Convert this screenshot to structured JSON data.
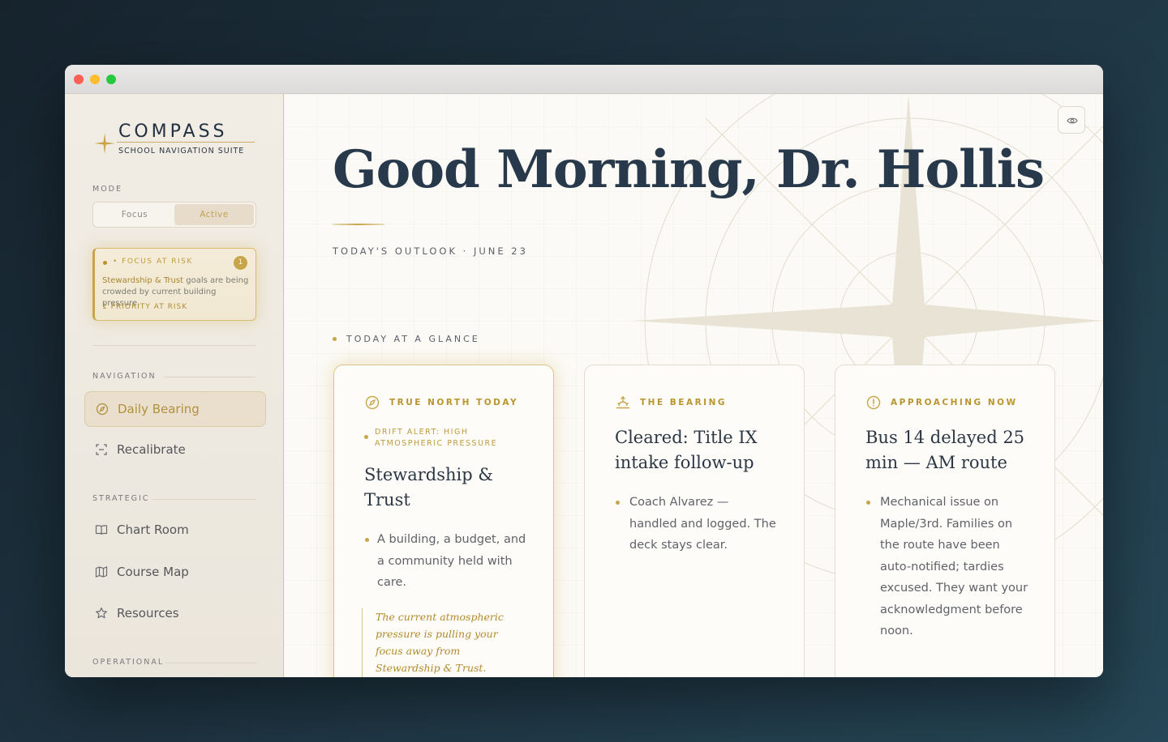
{
  "window": {
    "controls": [
      "close",
      "minimize",
      "zoom"
    ]
  },
  "brand": {
    "title": "COMPASS",
    "subtitle": "SCHOOL NAVIGATION SUITE",
    "icon": "compass-star-icon"
  },
  "mode": {
    "label": "MODE",
    "options": [
      "Focus",
      "Active"
    ],
    "selected": "Active"
  },
  "risk": {
    "title": "• FOCUS AT RISK",
    "count": "1",
    "highlight": "Stewardship & Trust",
    "text": " goals are being crowded by current building pressure.",
    "footer": "1 PRIORITY AT RISK"
  },
  "nav": {
    "navigation_label": "NAVIGATION",
    "strategic_label": "STRATEGIC",
    "operational_label": "OPERATIONAL",
    "items": [
      {
        "label": "Daily Bearing",
        "icon": "compass-icon",
        "selected": true
      },
      {
        "label": "Recalibrate",
        "icon": "scan-icon",
        "selected": false
      },
      {
        "label": "Chart Room",
        "icon": "book-icon",
        "selected": false
      },
      {
        "label": "Course Map",
        "icon": "map-icon",
        "selected": false
      },
      {
        "label": "Resources",
        "icon": "star-icon",
        "selected": false
      }
    ]
  },
  "main": {
    "greeting": "Good Morning, Dr. Hollis",
    "outlook": "TODAY'S OUTLOOK · JUNE 23",
    "glance_label": "TODAY AT A GLANCE",
    "visibility_icon": "eye-icon"
  },
  "cards": [
    {
      "kicker": "TRUE NORTH TODAY",
      "icon": "compass-icon",
      "drift": "DRIFT ALERT: HIGH ATMOSPHERIC PRESSURE",
      "title": "Stewardship & Trust",
      "body": "A building, a budget, and a community held with care.",
      "quote": "The current atmospheric pressure is pulling your focus away from Stewardship & Trust. Recalibrate to protect"
    },
    {
      "kicker": "THE BEARING",
      "icon": "sunrise-icon",
      "title": "Cleared: Title IX intake follow-up",
      "body": "Coach Alvarez — handled and logged. The deck stays clear."
    },
    {
      "kicker": "APPROACHING NOW",
      "icon": "alert-circle-icon",
      "title": "Bus 14 delayed 25 min — AM route",
      "body": "Mechanical issue on Maple/3rd. Families on the route have been auto-notified; tardies excused. They want your acknowledgment before noon."
    }
  ],
  "colors": {
    "accent": "#c8a54b",
    "ink": "#27394a",
    "sidebar": "#ece7dd"
  }
}
